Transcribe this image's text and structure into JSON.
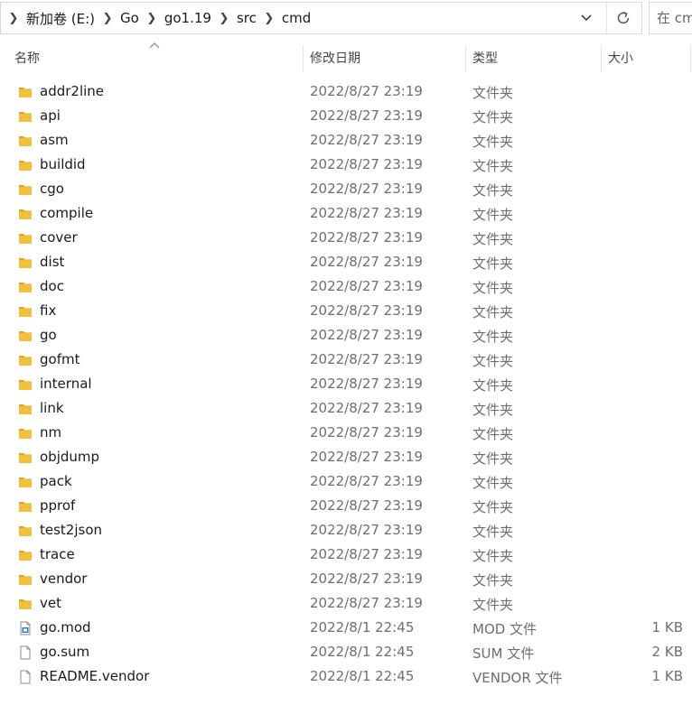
{
  "address_bar": {
    "breadcrumbs": [
      "新加卷 (E:)",
      "Go",
      "go1.19",
      "src",
      "cmd"
    ]
  },
  "search": {
    "placeholder": "在 cmd 中搜索"
  },
  "columns": {
    "name": "名称",
    "date": "修改日期",
    "type": "类型",
    "size": "大小"
  },
  "files": [
    {
      "name": "addr2line",
      "date": "2022/8/27 23:19",
      "type": "文件夹",
      "size": "",
      "icon": "folder-icon"
    },
    {
      "name": "api",
      "date": "2022/8/27 23:19",
      "type": "文件夹",
      "size": "",
      "icon": "folder-icon"
    },
    {
      "name": "asm",
      "date": "2022/8/27 23:19",
      "type": "文件夹",
      "size": "",
      "icon": "folder-icon"
    },
    {
      "name": "buildid",
      "date": "2022/8/27 23:19",
      "type": "文件夹",
      "size": "",
      "icon": "folder-icon"
    },
    {
      "name": "cgo",
      "date": "2022/8/27 23:19",
      "type": "文件夹",
      "size": "",
      "icon": "folder-icon"
    },
    {
      "name": "compile",
      "date": "2022/8/27 23:19",
      "type": "文件夹",
      "size": "",
      "icon": "folder-icon"
    },
    {
      "name": "cover",
      "date": "2022/8/27 23:19",
      "type": "文件夹",
      "size": "",
      "icon": "folder-icon"
    },
    {
      "name": "dist",
      "date": "2022/8/27 23:19",
      "type": "文件夹",
      "size": "",
      "icon": "folder-icon"
    },
    {
      "name": "doc",
      "date": "2022/8/27 23:19",
      "type": "文件夹",
      "size": "",
      "icon": "folder-icon"
    },
    {
      "name": "fix",
      "date": "2022/8/27 23:19",
      "type": "文件夹",
      "size": "",
      "icon": "folder-icon"
    },
    {
      "name": "go",
      "date": "2022/8/27 23:19",
      "type": "文件夹",
      "size": "",
      "icon": "folder-icon"
    },
    {
      "name": "gofmt",
      "date": "2022/8/27 23:19",
      "type": "文件夹",
      "size": "",
      "icon": "folder-icon"
    },
    {
      "name": "internal",
      "date": "2022/8/27 23:19",
      "type": "文件夹",
      "size": "",
      "icon": "folder-icon"
    },
    {
      "name": "link",
      "date": "2022/8/27 23:19",
      "type": "文件夹",
      "size": "",
      "icon": "folder-icon"
    },
    {
      "name": "nm",
      "date": "2022/8/27 23:19",
      "type": "文件夹",
      "size": "",
      "icon": "folder-icon"
    },
    {
      "name": "objdump",
      "date": "2022/8/27 23:19",
      "type": "文件夹",
      "size": "",
      "icon": "folder-icon"
    },
    {
      "name": "pack",
      "date": "2022/8/27 23:19",
      "type": "文件夹",
      "size": "",
      "icon": "folder-icon"
    },
    {
      "name": "pprof",
      "date": "2022/8/27 23:19",
      "type": "文件夹",
      "size": "",
      "icon": "folder-icon"
    },
    {
      "name": "test2json",
      "date": "2022/8/27 23:19",
      "type": "文件夹",
      "size": "",
      "icon": "folder-icon"
    },
    {
      "name": "trace",
      "date": "2022/8/27 23:19",
      "type": "文件夹",
      "size": "",
      "icon": "folder-icon"
    },
    {
      "name": "vendor",
      "date": "2022/8/27 23:19",
      "type": "文件夹",
      "size": "",
      "icon": "folder-icon"
    },
    {
      "name": "vet",
      "date": "2022/8/27 23:19",
      "type": "文件夹",
      "size": "",
      "icon": "folder-icon"
    },
    {
      "name": "go.mod",
      "date": "2022/8/1 22:45",
      "type": "MOD 文件",
      "size": "1 KB",
      "icon": "mod-file-icon"
    },
    {
      "name": "go.sum",
      "date": "2022/8/1 22:45",
      "type": "SUM 文件",
      "size": "2 KB",
      "icon": "file-icon"
    },
    {
      "name": "README.vendor",
      "date": "2022/8/1 22:45",
      "type": "VENDOR 文件",
      "size": "1 KB",
      "icon": "file-icon"
    }
  ],
  "colors": {
    "folder": "#f2c13b",
    "folder_dark": "#dca622",
    "border": "#d9d9d9",
    "secondary_text": "#6e6e6e"
  }
}
